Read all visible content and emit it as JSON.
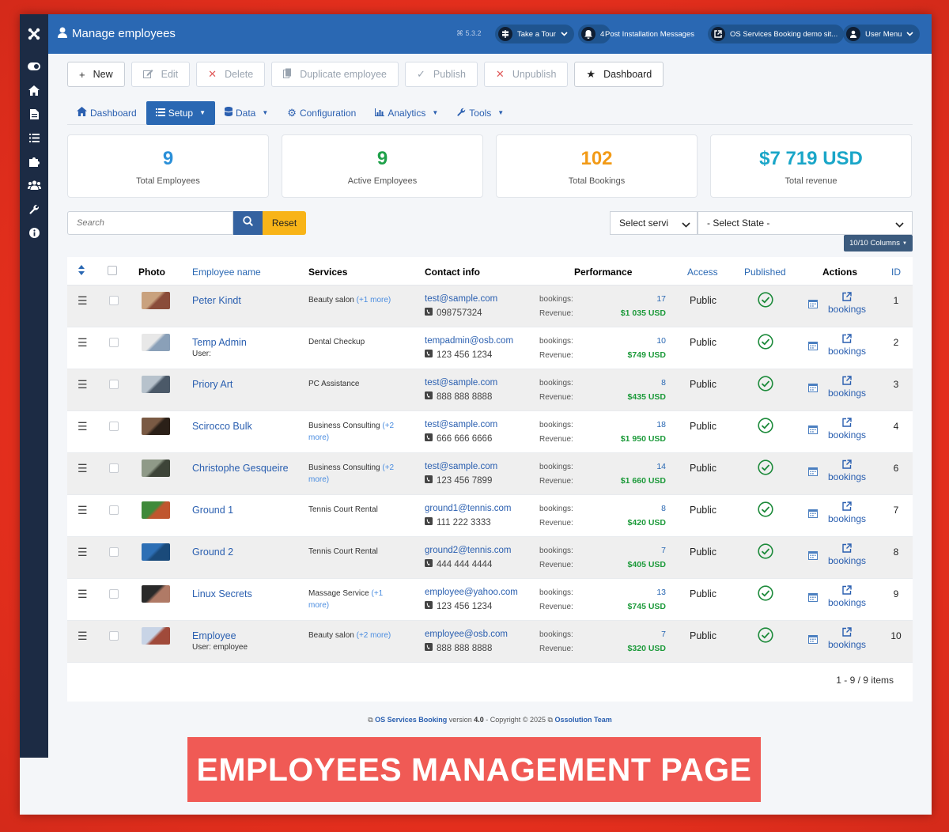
{
  "header": {
    "title": "Manage employees",
    "version": "5.3.2",
    "buttons": [
      {
        "label": "Take a Tour"
      },
      {
        "label": "4"
      },
      {
        "label": "Post Installation Messages"
      },
      {
        "label": "OS Services Booking demo sit..."
      },
      {
        "label": "User Menu"
      }
    ]
  },
  "toolbar": {
    "new": "New",
    "edit": "Edit",
    "delete": "Delete",
    "duplicate": "Duplicate employee",
    "publish": "Publish",
    "unpublish": "Unpublish",
    "dashboard": "Dashboard"
  },
  "nav": {
    "dashboard": "Dashboard",
    "setup": "Setup",
    "data": "Data",
    "configuration": "Configuration",
    "analytics": "Analytics",
    "tools": "Tools"
  },
  "stats": [
    {
      "value": "9",
      "label": "Total Employees",
      "color": "#2a8fd8"
    },
    {
      "value": "9",
      "label": "Active Employees",
      "color": "#1fa14a"
    },
    {
      "value": "102",
      "label": "Total Bookings",
      "color": "#f29a16"
    },
    {
      "value": "$7 719 USD",
      "label": "Total revenue",
      "color": "#1aa6c8"
    }
  ],
  "filters": {
    "search_placeholder": "Search",
    "reset": "Reset",
    "select_service": "Select servi",
    "select_state": "- Select State -",
    "columns": "10/10 Columns"
  },
  "table": {
    "headers": {
      "photo": "Photo",
      "name": "Employee name",
      "services": "Services",
      "contact": "Contact info",
      "performance": "Performance",
      "access": "Access",
      "published": "Published",
      "actions": "Actions",
      "id": "ID"
    },
    "bookings_label": "bookings:",
    "revenue_label": "Revenue:",
    "action_label": "bookings",
    "rows": [
      {
        "name": "Peter Kindt",
        "user": "",
        "service": "Beauty salon",
        "more": "(+1 more)",
        "email": "test@sample.com",
        "phone": "098757324",
        "bookings": "17",
        "revenue": "$1 035 USD",
        "access": "Public",
        "id": "1"
      },
      {
        "name": "Temp Admin",
        "user": "User:",
        "service": "Dental Checkup",
        "more": "",
        "email": "tempadmin@osb.com",
        "phone": "123 456 1234",
        "bookings": "10",
        "revenue": "$749 USD",
        "access": "Public",
        "id": "2"
      },
      {
        "name": "Priory Art",
        "user": "",
        "service": "PC Assistance",
        "more": "",
        "email": "test@sample.com",
        "phone": "888 888 8888",
        "bookings": "8",
        "revenue": "$435 USD",
        "access": "Public",
        "id": "3"
      },
      {
        "name": "Scirocco Bulk",
        "user": "",
        "service": "Business Consulting",
        "more": "(+2 more)",
        "email": "test@sample.com",
        "phone": "666 666 6666",
        "bookings": "18",
        "revenue": "$1 950 USD",
        "access": "Public",
        "id": "4"
      },
      {
        "name": "Christophe Gesqueire",
        "user": "",
        "service": "Business Consulting",
        "more": "(+2 more)",
        "email": "test@sample.com",
        "phone": "123 456 7899",
        "bookings": "14",
        "revenue": "$1 660 USD",
        "access": "Public",
        "id": "6"
      },
      {
        "name": "Ground 1",
        "user": "",
        "service": "Tennis Court Rental",
        "more": "",
        "email": "ground1@tennis.com",
        "phone": "111 222 3333",
        "bookings": "8",
        "revenue": "$420 USD",
        "access": "Public",
        "id": "7"
      },
      {
        "name": "Ground 2",
        "user": "",
        "service": "Tennis Court Rental",
        "more": "",
        "email": "ground2@tennis.com",
        "phone": "444 444 4444",
        "bookings": "7",
        "revenue": "$405 USD",
        "access": "Public",
        "id": "8"
      },
      {
        "name": "Linux Secrets",
        "user": "",
        "service": "Massage Service",
        "more": "(+1 more)",
        "email": "employee@yahoo.com",
        "phone": "123 456 1234",
        "bookings": "13",
        "revenue": "$745 USD",
        "access": "Public",
        "id": "9"
      },
      {
        "name": "Employee",
        "user": "User: employee",
        "service": "Beauty salon",
        "more": "(+2 more)",
        "email": "employee@osb.com",
        "phone": "888 888 8888",
        "bookings": "7",
        "revenue": "$320 USD",
        "access": "Public",
        "id": "10"
      }
    ],
    "pager": "1 - 9 / 9 items"
  },
  "footer": {
    "product": "OS Services Booking",
    "version_text": "version",
    "version": "4.0",
    "copyright": "- Copyright © 2025",
    "team": "Ossolution Team"
  },
  "banner": "EMPLOYEES MANAGEMENT PAGE"
}
